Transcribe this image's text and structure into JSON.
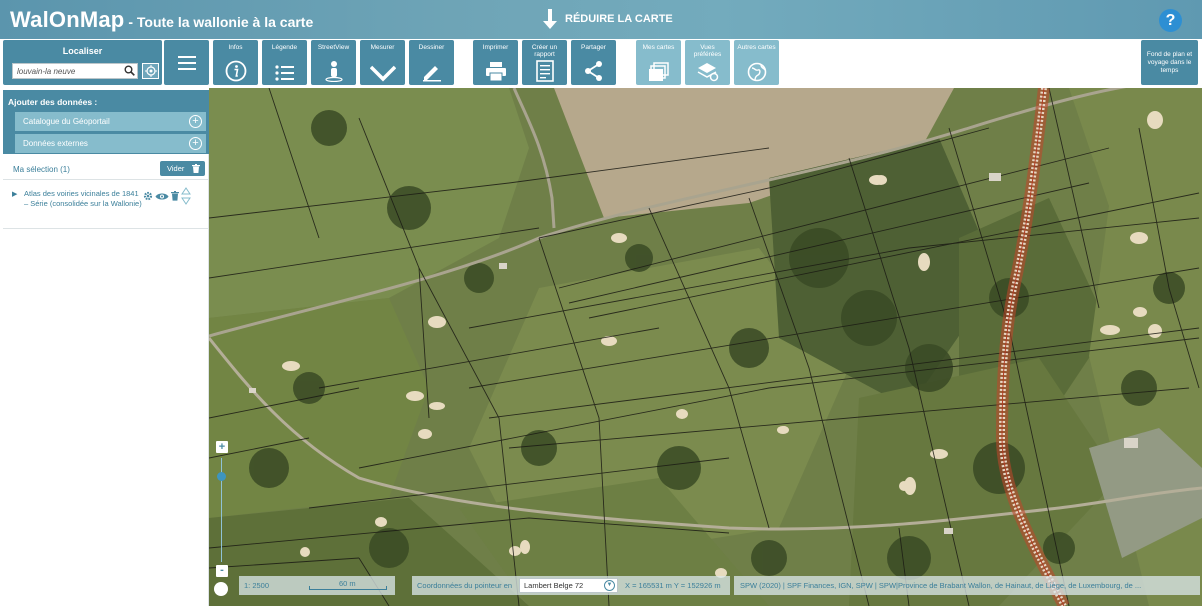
{
  "header": {
    "brand_name": "WalOnMap",
    "brand_tagline": " - Toute la wallonie à la carte",
    "reduce_label": "RÉDUIRE LA CARTE",
    "help_label": "?"
  },
  "localiser": {
    "title": "Localiser",
    "search_value": "louvain-la neuve"
  },
  "tools": {
    "infos": "Infos",
    "legende": "Légende",
    "streetview": "StreetView",
    "mesurer": "Mesurer",
    "dessiner": "Dessiner",
    "imprimer": "Imprimer",
    "rapport": "Créer un rapport",
    "partager": "Partager",
    "mes_cartes": "Mes cartes",
    "vues": "Vues préférées",
    "autres": "Autres cartes",
    "fond": "Fond de plan et voyage dans le temps"
  },
  "panel": {
    "add_title": "Ajouter des données :",
    "catalogue": "Catalogue du Géoportail",
    "externes": "Données externes",
    "selection_title": "Ma sélection (1)",
    "vider_label": "Vider",
    "layer_name": "Atlas des voiries vicinales de 1841 – Série (consolidée sur la Wallonie)"
  },
  "map": {
    "zoom_in": "+",
    "zoom_out": "-",
    "scale_ratio": "1: 2500",
    "scale_distance": "60 m",
    "coords_label": "Coordonnées du pointeur en",
    "projection": "Lambert Belge 72",
    "coords_values": "X = 165531 m   Y = 152926 m",
    "attribution": "SPW (2020) | SPF Finances, IGN, SPW | SPW|Province de Brabant Wallon, de Hainaut, de Liège, de Luxembourg, de ..."
  },
  "colors": {
    "header": "#5b95ad",
    "tool_button": "#4a8aa3",
    "tool_button_light": "#86bccc",
    "help": "#2d8fd3",
    "railway": "#c2462a"
  }
}
